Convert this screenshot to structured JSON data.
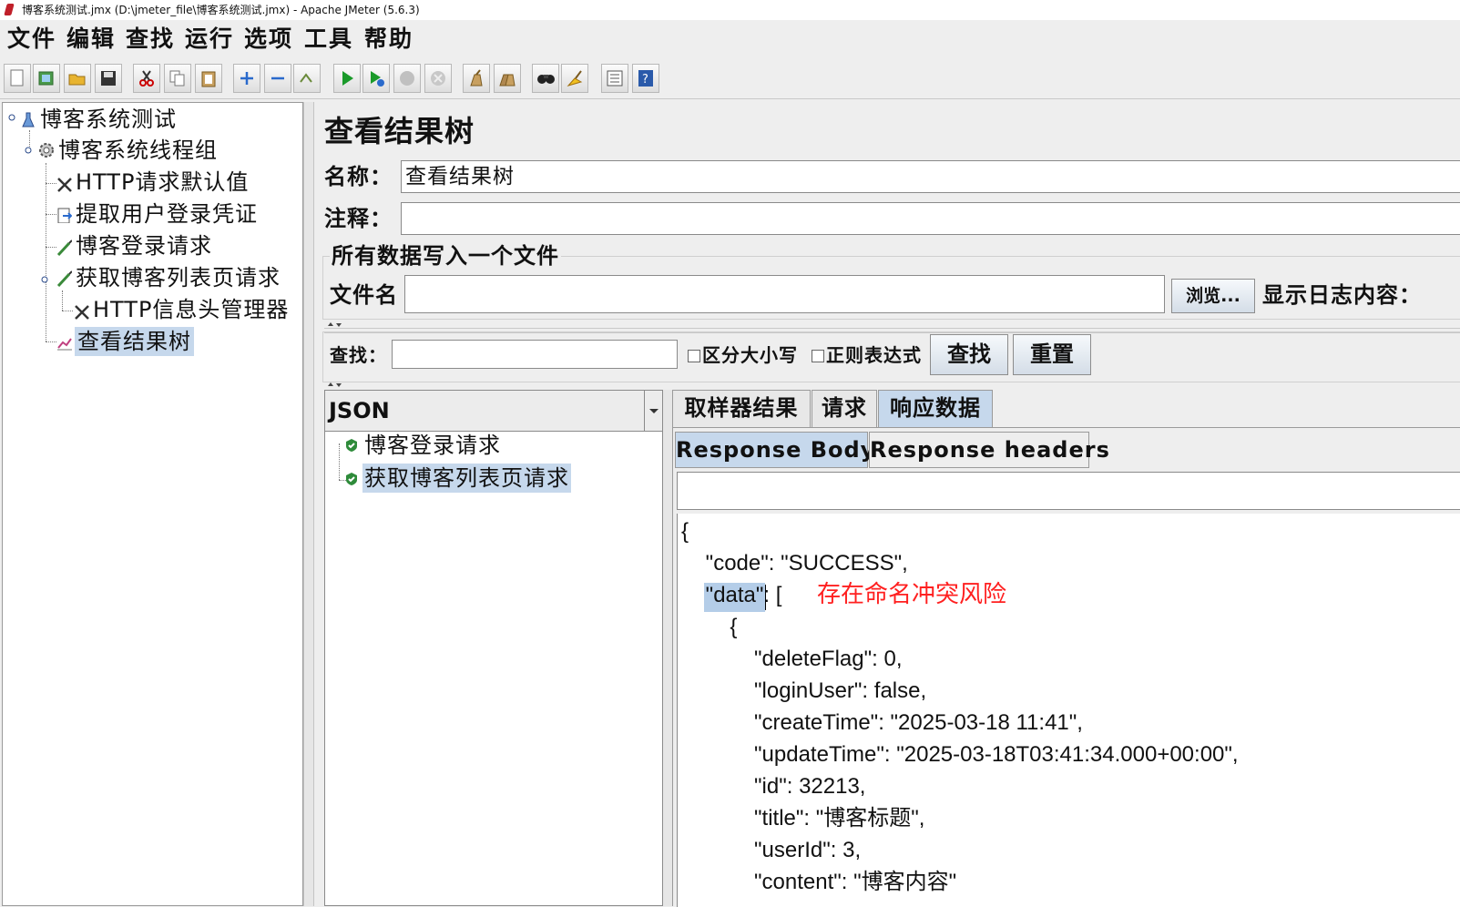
{
  "window": {
    "title": "博客系统测试.jmx (D:\\jmeter_file\\博客系统测试.jmx) - Apache JMeter (5.6.3)"
  },
  "menu": [
    "文件",
    "编辑",
    "查找",
    "运行",
    "选项",
    "工具",
    "帮助"
  ],
  "toolbar": [
    "new-icon",
    "templates-icon",
    "open-icon",
    "save-icon",
    "cut-icon",
    "copy-icon",
    "paste-icon",
    "expand-icon",
    "collapse-icon",
    "toggle-icon",
    "start-icon",
    "start-no-pause-icon",
    "stop-icon",
    "shutdown-icon",
    "clear-icon",
    "clear-all-icon",
    "search-icon",
    "reset-search-icon",
    "function-helper-icon",
    "help-icon"
  ],
  "tree": {
    "items": [
      {
        "label": "博客系统测试"
      },
      {
        "label": "博客系统线程组"
      },
      {
        "label": "HTTP请求默认值"
      },
      {
        "label": "提取用户登录凭证"
      },
      {
        "label": "博客登录请求"
      },
      {
        "label": "获取博客列表页请求"
      },
      {
        "label": "HTTP信息头管理器"
      },
      {
        "label": "查看结果树"
      }
    ]
  },
  "panel": {
    "title": "查看结果树",
    "name_label": "名称：",
    "name_value": "查看结果树",
    "comment_label": "注释：",
    "comment_value": "",
    "file_section_title": "所有数据写入一个文件",
    "file_label": "文件名",
    "file_value": "",
    "browse_button": "浏览...",
    "log_label": "显示日志内容："
  },
  "search": {
    "label": "查找：",
    "value": "",
    "case_sensitive": "区分大小写",
    "regex": "正则表达式",
    "find_button": "查找",
    "reset_button": "重置"
  },
  "renderer": {
    "selected": "JSON"
  },
  "results": [
    {
      "label": "博客登录请求",
      "status": "success"
    },
    {
      "label": "获取博客列表页请求",
      "status": "success"
    }
  ],
  "tabs": [
    "取样器结果",
    "请求",
    "响应数据"
  ],
  "subtabs": [
    "Response Body",
    "Response headers"
  ],
  "response": {
    "lines": [
      "{",
      "    \"code\": \"SUCCESS\",",
      "    \"data\": [",
      "        {",
      "            \"deleteFlag\": 0,",
      "            \"loginUser\": false,",
      "            \"createTime\": \"2025-03-18 11:41\",",
      "            \"updateTime\": \"2025-03-18T03:41:34.000+00:00\",",
      "            \"id\": 32213,",
      "            \"title\": \"博客标题\",",
      "            \"userId\": 3,",
      "            \"content\": \"博客内容\""
    ],
    "highlight": "\"data\""
  },
  "annotation": {
    "text": "存在命名冲突风险",
    "color": "#ff2020"
  },
  "colors": {
    "selection": "#c6d8ec",
    "success": "#2e8b3a"
  }
}
